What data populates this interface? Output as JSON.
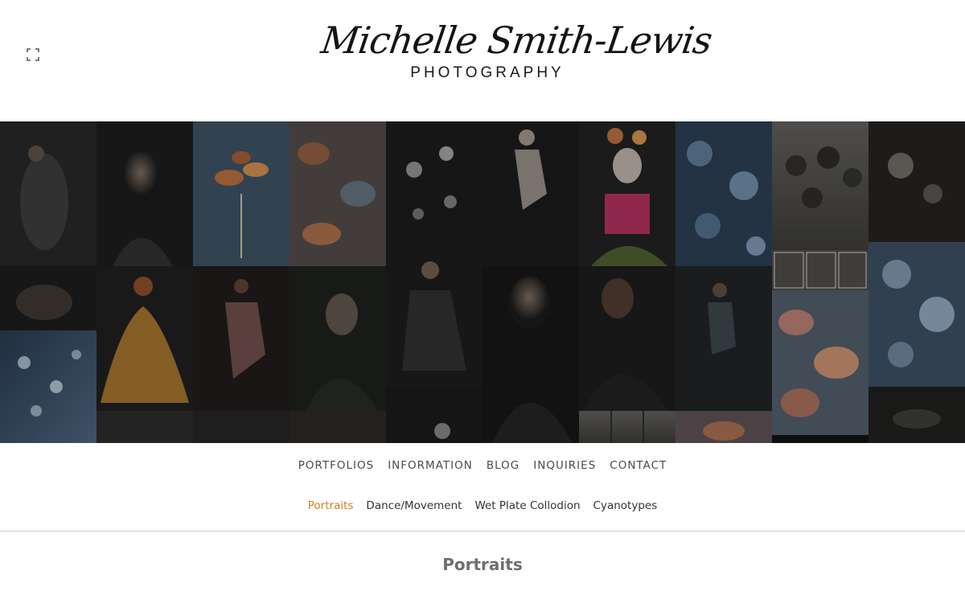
{
  "logo": {
    "script_text": "Michelle Smith-Lewis",
    "subtitle": "PHOTOGRAPHY"
  },
  "controls": {
    "fullscreen_icon": "fullscreen-icon"
  },
  "mosaic": {
    "tiles": [
      {
        "name": "woman-dark-dress",
        "color": "#2a2a2a"
      },
      {
        "name": "woman-portrait",
        "color": "#1c1c1c"
      },
      {
        "name": "cyanotype-leaves",
        "color": "#3a4e60"
      },
      {
        "name": "cyanotype-autumn-leaves",
        "color": "#5a4e48"
      },
      {
        "name": "dark-flowers",
        "color": "#1e1e1e"
      },
      {
        "name": "child-jumping",
        "color": "#1b1b1b"
      },
      {
        "name": "day-of-the-dead-portrait",
        "color": "#3b2a2a"
      },
      {
        "name": "cyanotype-maple-leaves",
        "color": "#2d4055"
      },
      {
        "name": "wet-plate-alliums",
        "color": "#4a4843"
      },
      {
        "name": "wet-plate-thistle",
        "color": "#242220"
      },
      {
        "name": "woman-back-pose",
        "color": "#1c1c1c"
      },
      {
        "name": "pregnant-woman-yellow-dress",
        "color": "#3a2e1c"
      },
      {
        "name": "dancer-mauve-dress",
        "color": "#221c1c"
      },
      {
        "name": "profile-portrait",
        "color": "#1f1f1f"
      },
      {
        "name": "woman-seated",
        "color": "#1e1e1e"
      },
      {
        "name": "blonde-portrait",
        "color": "#1c1c1c"
      },
      {
        "name": "man-portrait",
        "color": "#1c1c1c"
      },
      {
        "name": "dancer-jumping",
        "color": "#1f2224"
      },
      {
        "name": "wet-plate-ferns",
        "color": "#3a3a38"
      },
      {
        "name": "cyanotype-pink-leaves",
        "color": "#4e5a66"
      },
      {
        "name": "cyanotype-blue-leaves",
        "color": "#3a4c60"
      },
      {
        "name": "cyanotype-clover",
        "color": "#34465a"
      }
    ]
  },
  "nav": {
    "main": [
      "PORTFOLIOS",
      "INFORMATION",
      "BLOG",
      "INQUIRIES",
      "CONTACT"
    ],
    "sub": [
      "Portraits",
      "Dance/Movement",
      "Wet Plate Collodion",
      "Cyanotypes"
    ],
    "active_sub": "Portraits"
  },
  "page": {
    "title": "Portraits"
  },
  "colors": {
    "accent": "#d87c20",
    "nav_text": "#4a4a4a",
    "title_text": "#6e6e6e"
  }
}
